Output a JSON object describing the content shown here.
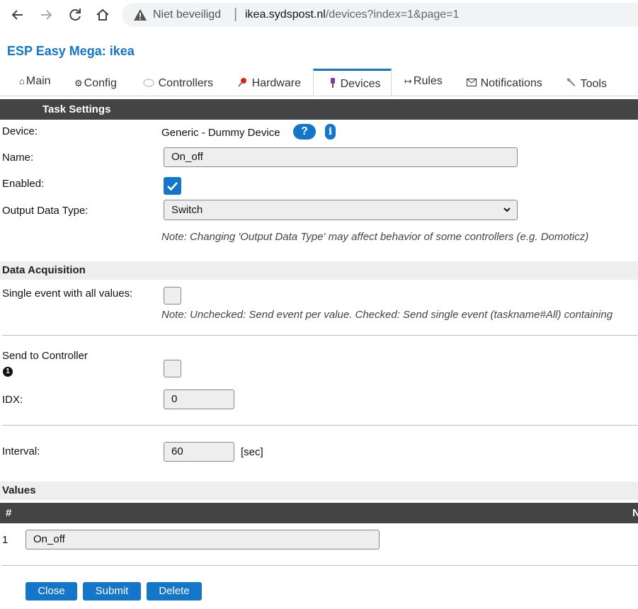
{
  "browser": {
    "insecure_label": "Niet beveiligd",
    "url_host": "ikea.sydspost.nl",
    "url_path": "/devices?index=1&page=1"
  },
  "page_title": "ESP Easy Mega: ikea",
  "tabs": [
    {
      "label": "Main",
      "icon": "house-icon"
    },
    {
      "label": "Config",
      "icon": "gear-icon"
    },
    {
      "label": "Controllers",
      "icon": "speech-bubble-icon"
    },
    {
      "label": "Hardware",
      "icon": "pushpin-icon"
    },
    {
      "label": "Devices",
      "icon": "plug-icon",
      "active": true
    },
    {
      "label": "Rules",
      "icon": "arrow-icon"
    },
    {
      "label": "Notifications",
      "icon": "envelope-icon"
    },
    {
      "label": "Tools",
      "icon": "wrench-icon"
    }
  ],
  "task_settings": {
    "header": "Task Settings",
    "device_label": "Device:",
    "device_value": "Generic - Dummy Device",
    "help_symbol": "?",
    "info_symbol": "i",
    "name_label": "Name:",
    "name_value": "On_off",
    "enabled_label": "Enabled:",
    "enabled": true,
    "output_type_label": "Output Data Type:",
    "output_type_value": "Switch",
    "output_note": "Note: Changing 'Output Data Type' may affect behavior of some controllers (e.g. Domoticz)"
  },
  "data_acquisition": {
    "header": "Data Acquisition",
    "single_event_label": "Single event with all values:",
    "single_event": false,
    "single_event_note": "Note: Unchecked: Send event per value. Checked: Send single event (taskname#All) containing",
    "send_to_controller_label": "Send to Controller",
    "controller_number": "1",
    "send_to_controller": false,
    "idx_label": "IDX:",
    "idx_value": "0",
    "interval_label": "Interval:",
    "interval_value": "60",
    "interval_unit": "[sec]"
  },
  "values": {
    "header": "Values",
    "col_index": "#",
    "col_name_partial": "N",
    "rows": [
      {
        "index": "1",
        "name": "On_off"
      }
    ]
  },
  "buttons": {
    "close": "Close",
    "submit": "Submit",
    "delete": "Delete"
  },
  "colors": {
    "accent": "#1576c9",
    "header_bar": "#444444",
    "subheader_bar": "#eeeeee"
  }
}
